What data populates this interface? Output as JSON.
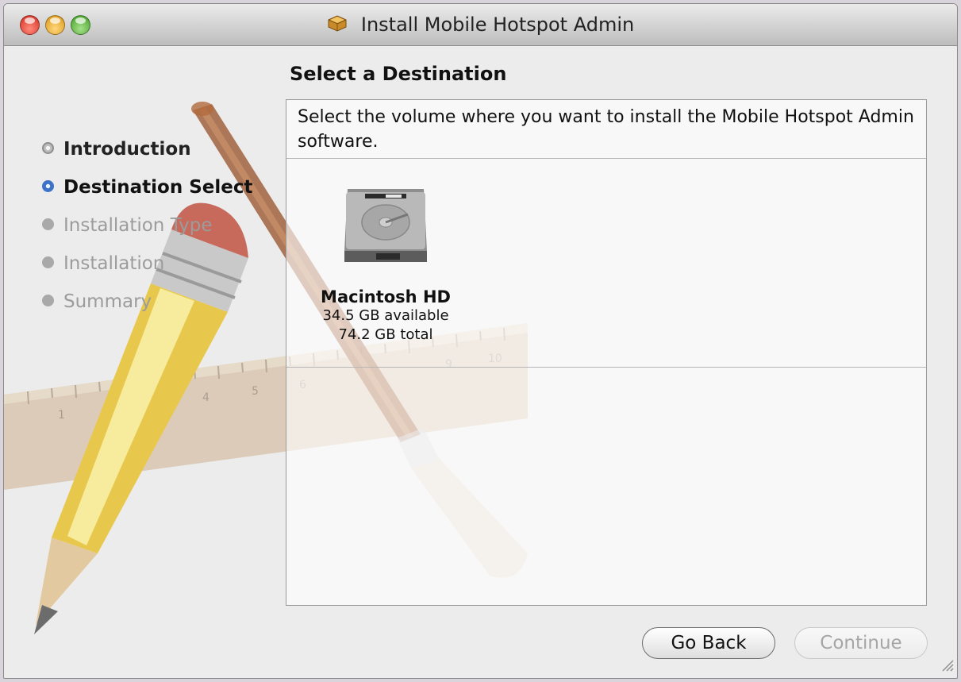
{
  "window": {
    "title": "Install Mobile Hotspot Admin"
  },
  "page": {
    "heading": "Select a Destination"
  },
  "sidebar": {
    "steps": [
      {
        "label": "Introduction",
        "state": "done"
      },
      {
        "label": "Destination Select",
        "state": "current"
      },
      {
        "label": "Installation Type",
        "state": "pending"
      },
      {
        "label": "Installation",
        "state": "pending"
      },
      {
        "label": "Summary",
        "state": "pending"
      }
    ]
  },
  "panel": {
    "instructions": "Select the volume where you want to install the Mobile Hotspot Admin software."
  },
  "volume": {
    "name": "Macintosh HD",
    "available": "34.5 GB available",
    "total": "74.2 GB total"
  },
  "art": {
    "ruler_ticks": [
      "1",
      "4",
      "5",
      "6",
      "9",
      "10"
    ]
  },
  "buttons": {
    "back": "Go Back",
    "continue": "Continue"
  },
  "colors": {
    "accent": "#3c72c8",
    "disabled_text": "#a6a6a6"
  }
}
